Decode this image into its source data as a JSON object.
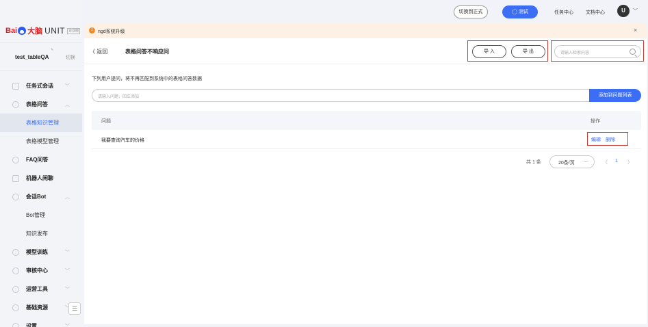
{
  "brand": {
    "bai": "Bai",
    "danao": "大脑",
    "unit": "UNIT",
    "edition": "企业版"
  },
  "app": {
    "name": "test_tableQA",
    "switch_label": "切换"
  },
  "sidebar": {
    "items": [
      {
        "label": "任务式会话",
        "chevron": "﹀",
        "icon": "task-icon"
      },
      {
        "label": "表格问答",
        "chevron": "︿",
        "icon": "table-icon"
      },
      {
        "label": "表格知识管理",
        "sub": true,
        "active": true
      },
      {
        "label": "表格模型管理",
        "sub": true
      },
      {
        "label": "FAQ问答",
        "chevron": "",
        "icon": "faq-icon"
      },
      {
        "label": "机器人闲聊",
        "chevron": "",
        "icon": "chat-icon"
      },
      {
        "label": "会话Bot",
        "chevron": "︿",
        "icon": "bot-icon"
      },
      {
        "label": "Bot管理",
        "sub": true
      },
      {
        "label": "知识发布",
        "sub": true
      },
      {
        "label": "模型训练",
        "chevron": "﹀",
        "icon": "model-icon"
      },
      {
        "label": "审核中心",
        "chevron": "﹀",
        "icon": "review-icon"
      },
      {
        "label": "运营工具",
        "chevron": "﹀",
        "icon": "ops-icon"
      },
      {
        "label": "基础资源",
        "chevron": "﹀",
        "icon": "resource-icon"
      },
      {
        "label": "设置",
        "chevron": "﹀",
        "icon": "settings-icon"
      }
    ],
    "collapse_glyph": "☰"
  },
  "topbar": {
    "switch_formal": "切换到正式",
    "test": "测试",
    "task_center": "任务中心",
    "doc_center": "文档中心",
    "avatar_letter": "U",
    "avatar_chevron": "﹀"
  },
  "notice": {
    "icon_text": "!",
    "text": "ngd系统升级",
    "close": "×"
  },
  "header": {
    "back": "〈 返回",
    "title": "表格问答不响应问",
    "import": "导 入",
    "export": "导 出",
    "search_placeholder": "请输入检索内容"
  },
  "main": {
    "description": "下列用户提问，将不再匹配到系统中的表格问答数据",
    "add_placeholder": "请输入问题，回车添加",
    "add_button": "添加到问题列表"
  },
  "table": {
    "col_question": "问题",
    "col_ops": "操作",
    "rows": [
      {
        "question": "我要查询汽车的价格",
        "edit": "编辑",
        "delete": "删除"
      }
    ]
  },
  "pagination": {
    "total": "共 1 条",
    "page_size": "20条/页",
    "prev": "〈",
    "current": "1",
    "next": "〉"
  },
  "colors": {
    "accent": "#3b6df5",
    "highlight": "#d13a2c",
    "notice_bg": "#fcf1e4"
  }
}
